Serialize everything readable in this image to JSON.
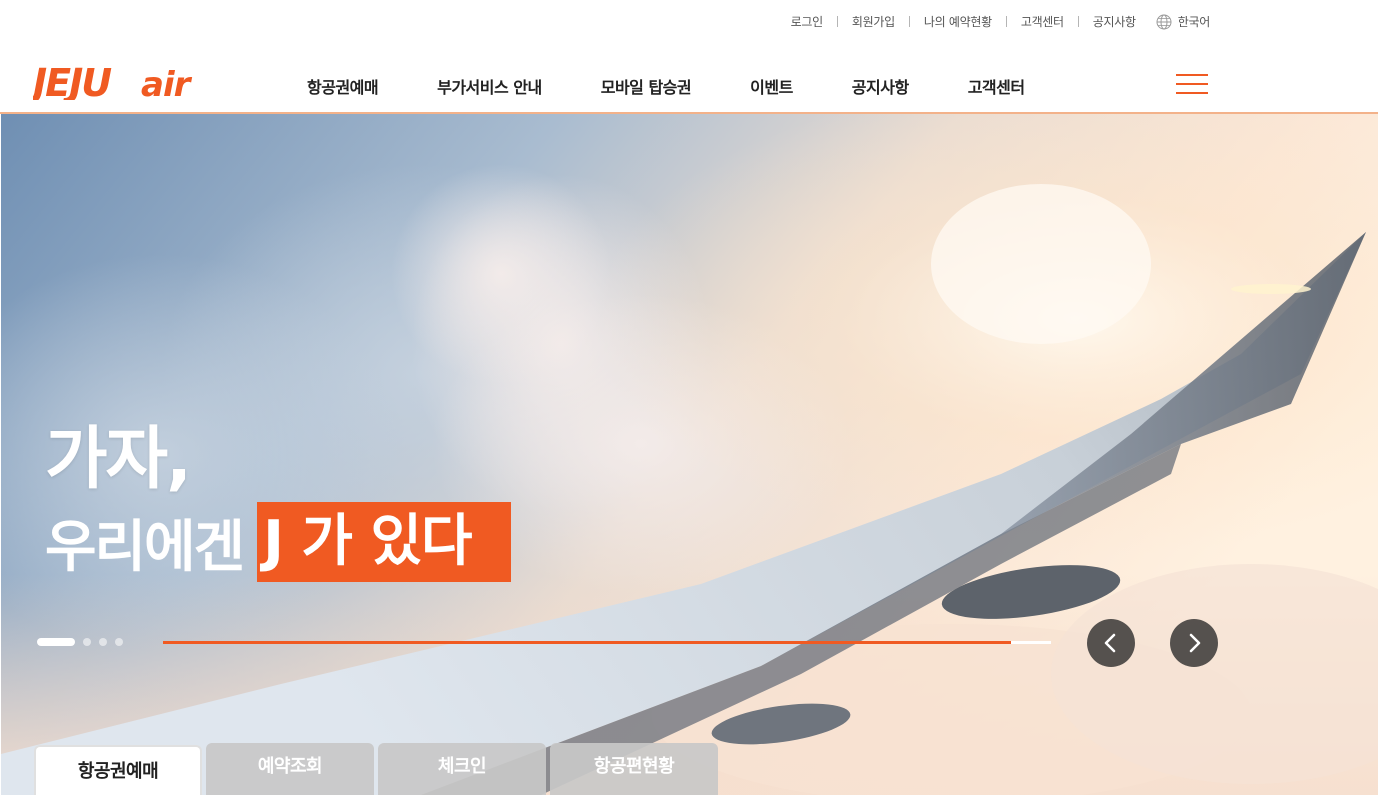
{
  "utility": {
    "links": [
      "로그인",
      "회원가입",
      "나의 예약현황",
      "고객센터",
      "공지사항"
    ],
    "language": "한국어"
  },
  "header": {
    "logo_text": "JEJUair",
    "menu": [
      "항공권예매",
      "부가서비스 안내",
      "모바일 탑승권",
      "이벤트",
      "공지사항",
      "고객센터"
    ]
  },
  "hero": {
    "line1": "가자,",
    "line2_plain": "우리에겐",
    "line2_highlight": "J 가 있다",
    "slide_count": 4,
    "active_slide": 1,
    "progress_fraction": 0.955
  },
  "tabs": [
    {
      "label": "항공권예매",
      "active": true
    },
    {
      "label": "예약조회",
      "active": false
    },
    {
      "label": "체크인",
      "active": false
    },
    {
      "label": "항공편현황",
      "active": false
    }
  ],
  "colors": {
    "brand": "#f05a22",
    "nav_divider": "#f3b28a"
  },
  "icons": {
    "language": "globe-icon",
    "menu": "hamburger-icon",
    "prev": "chevron-left-icon",
    "next": "chevron-right-icon"
  }
}
